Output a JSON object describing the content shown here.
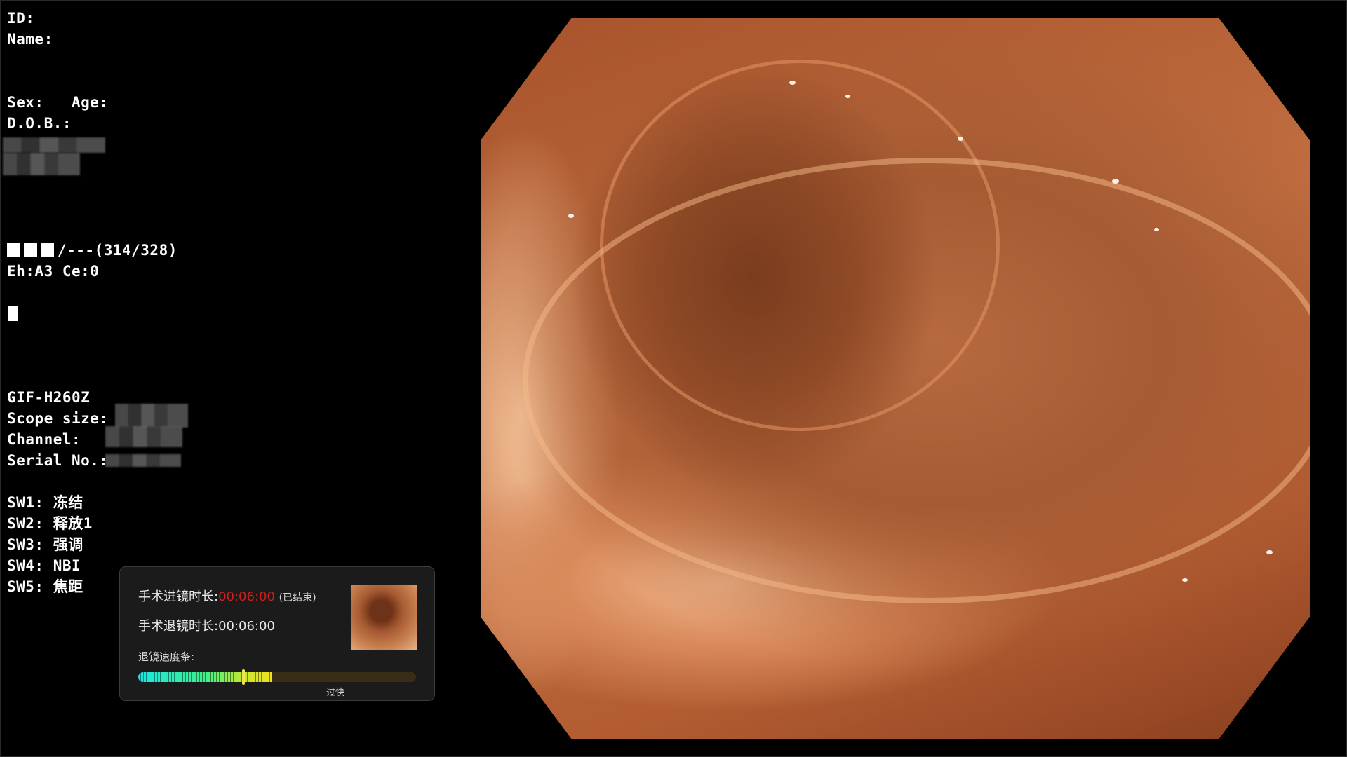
{
  "patient": {
    "id_label": "ID:",
    "name_label": "Name:",
    "sex_age_label": "Sex:   Age:",
    "dob_label": "D.O.B.:"
  },
  "status": {
    "line1_text": "/---(314/328)",
    "line2_text": "Eh:A3 Ce:0"
  },
  "scope": {
    "model": "GIF-H260Z",
    "scope_size_label": "Scope size:",
    "channel_label": "Channel:",
    "serial_label": "Serial No.:"
  },
  "switches": [
    {
      "label": "SW1: 冻结"
    },
    {
      "label": "SW2: 释放1"
    },
    {
      "label": "SW3: 强调"
    },
    {
      "label": "SW4: NBI"
    },
    {
      "label": "SW5: 焦距"
    }
  ],
  "panel": {
    "insertion_label": "手术进镜时长:",
    "insertion_time": "00:06:00",
    "insertion_status": "(已结束)",
    "withdrawal_label": "手术退镜时长:",
    "withdrawal_time": "00:06:00",
    "speed_bar_label": "退镜速度条:",
    "speed_caption": "过快",
    "speed_fill_fraction": 0.48,
    "speed_marker_fraction": 0.38
  },
  "colors": {
    "accent_red": "#d21e1e",
    "bar_start": "#19e6e6",
    "bar_end": "#f0e020"
  },
  "icons": {
    "status_squares": "three-white-squares",
    "cursor": "white-block-cursor"
  }
}
